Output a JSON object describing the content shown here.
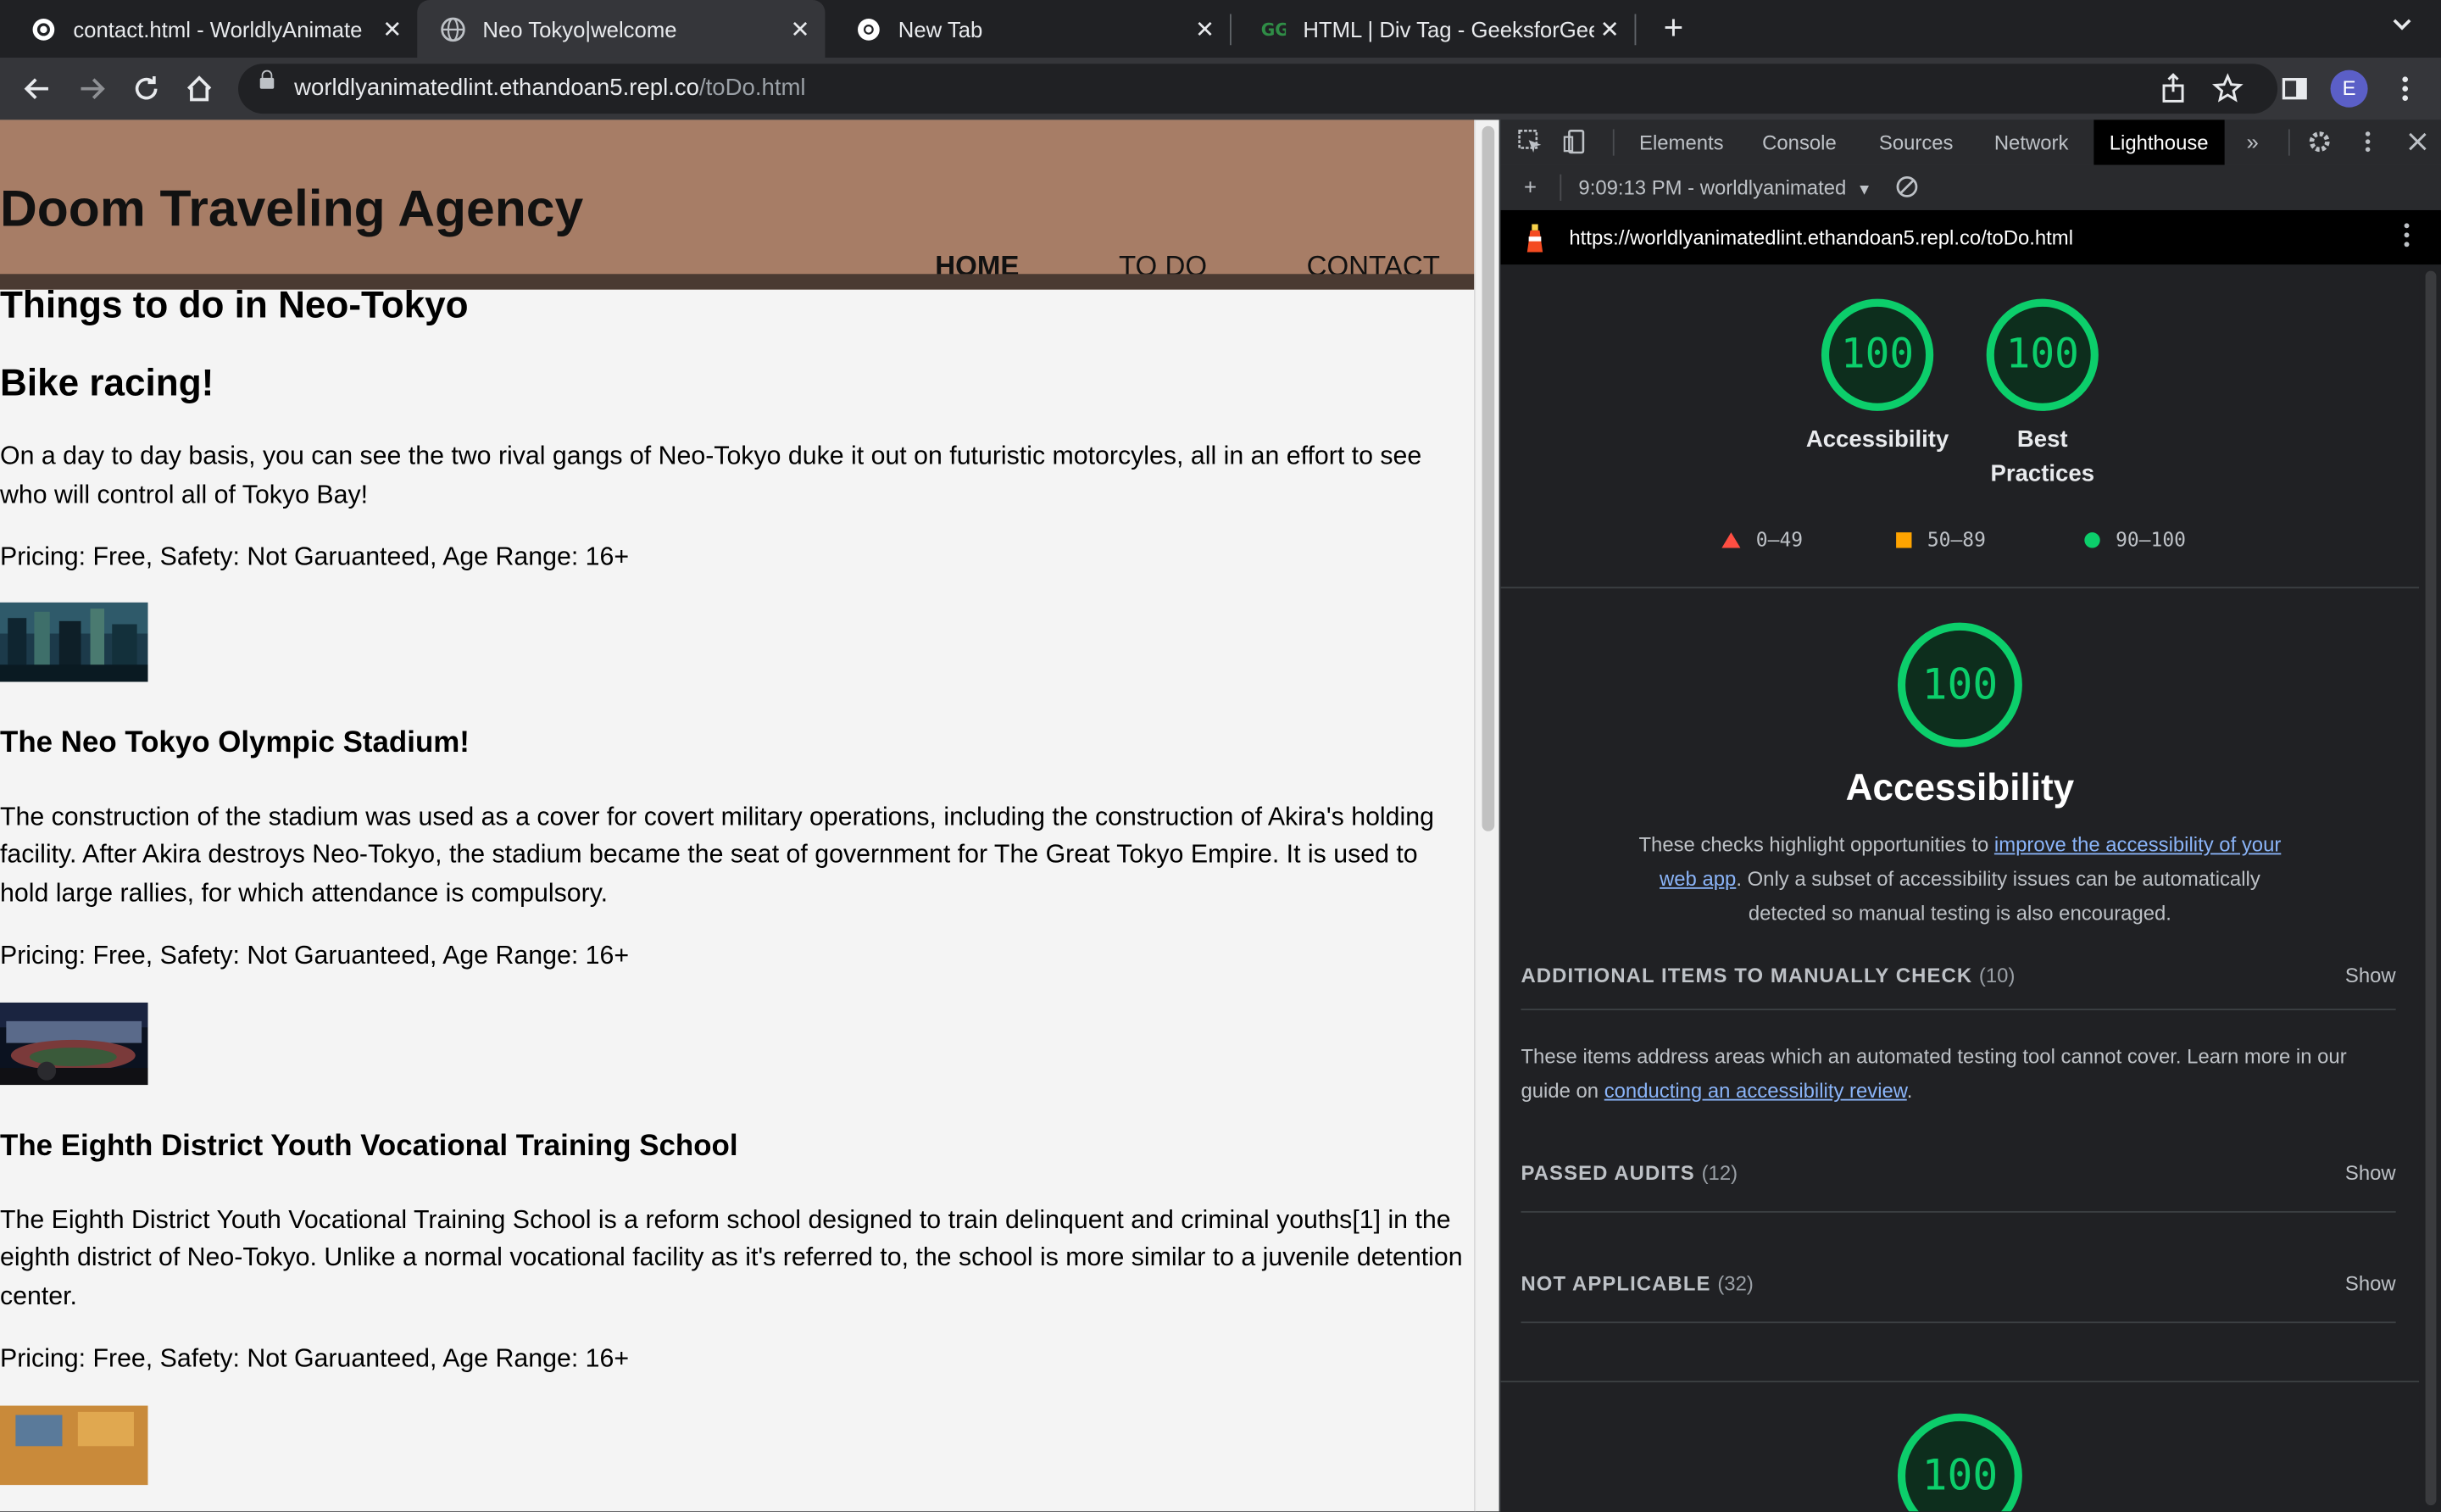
{
  "tabs": [
    {
      "label": "contact.html - WorldlyAnimate",
      "icon": "replit-icon",
      "close": "✕"
    },
    {
      "label": "Neo Tokyo|welcome",
      "icon": "globe-icon",
      "close": "✕"
    },
    {
      "label": "New Tab",
      "icon": "chrome-icon",
      "close": "✕"
    },
    {
      "label": "HTML | Div Tag - GeeksforGeek",
      "icon": "gfg-icon",
      "close": "✕"
    }
  ],
  "toolbar": {
    "url_host": "worldlyanimatedlint.ethandoan5.repl.co",
    "url_path": "/toDo.html",
    "avatar_letter": "E"
  },
  "site": {
    "title": "Doom Traveling Agency",
    "nav": [
      "HOME",
      "TO DO",
      "CONTACT"
    ],
    "heading": "Things to do in Neo-Tokyo",
    "sections": [
      {
        "title": "Bike racing!",
        "body": "On a day to day basis, you can see the two rival gangs of Neo-Tokyo duke it out on futuristic motorcyles, all in an effort to see who will control all of Tokyo Bay!",
        "pricing": "Pricing: Free, Safety: Not Garuanteed, Age Range: 16+"
      },
      {
        "title": "The Neo Tokyo Olympic Stadium!",
        "body": "The construction of the stadium was used as a cover for covert military operations, including the construction of Akira's holding facility. After Akira destroys Neo-Tokyo, the stadium became the seat of government for The Great Tokyo Empire. It is used to hold large rallies, for which attendance is compulsory.",
        "pricing": "Pricing: Free, Safety: Not Garuanteed, Age Range: 16+"
      },
      {
        "title": "The Eighth District Youth Vocational Training School",
        "body": "The Eighth District Youth Vocational Training School is a reform school designed to train delinquent and criminal youths[1] in the eighth district of Neo-Tokyo. Unlike a normal vocational facility as it's referred to, the school is more similar to a juvenile detention center.",
        "pricing": "Pricing: Free, Safety: Not Garuanteed, Age Range: 16+"
      }
    ]
  },
  "devtools": {
    "tabs": [
      "Elements",
      "Console",
      "Sources",
      "Network",
      "Lighthouse"
    ],
    "report_time": "9:09:13 PM - worldlyanimated",
    "report_url": "https://worldlyanimatedlint.ethandoan5.repl.co/toDo.html",
    "gauges": [
      {
        "score": "100",
        "label": "Accessibility"
      },
      {
        "score": "100",
        "label": "Best Practices"
      }
    ],
    "legend": [
      "0–49",
      "50–89",
      "90–100"
    ],
    "category": {
      "score": "100",
      "title": "Accessibility",
      "desc_before": "These checks highlight opportunities to ",
      "desc_link": "improve the accessibility of your web app",
      "desc_after": ". Only a subset of accessibility issues can be automatically detected so manual testing is also encouraged."
    },
    "groups": [
      {
        "title": "ADDITIONAL ITEMS TO MANUALLY CHECK",
        "count": "(10)",
        "action": "Show"
      },
      {
        "title": "PASSED AUDITS",
        "count": "(12)",
        "action": "Show"
      },
      {
        "title": "NOT APPLICABLE",
        "count": "(32)",
        "action": "Show"
      }
    ],
    "manual_desc_before": "These items address areas which an automated testing tool cannot cover. Learn more in our guide on ",
    "manual_desc_link": "conducting an accessibility review",
    "manual_desc_after": ".",
    "next_score": "100"
  },
  "colors": {
    "header_bg": "#a77d66",
    "pass_green": "#0cce6b",
    "fail_red": "#ff4e42",
    "average_orange": "#ffa400"
  }
}
